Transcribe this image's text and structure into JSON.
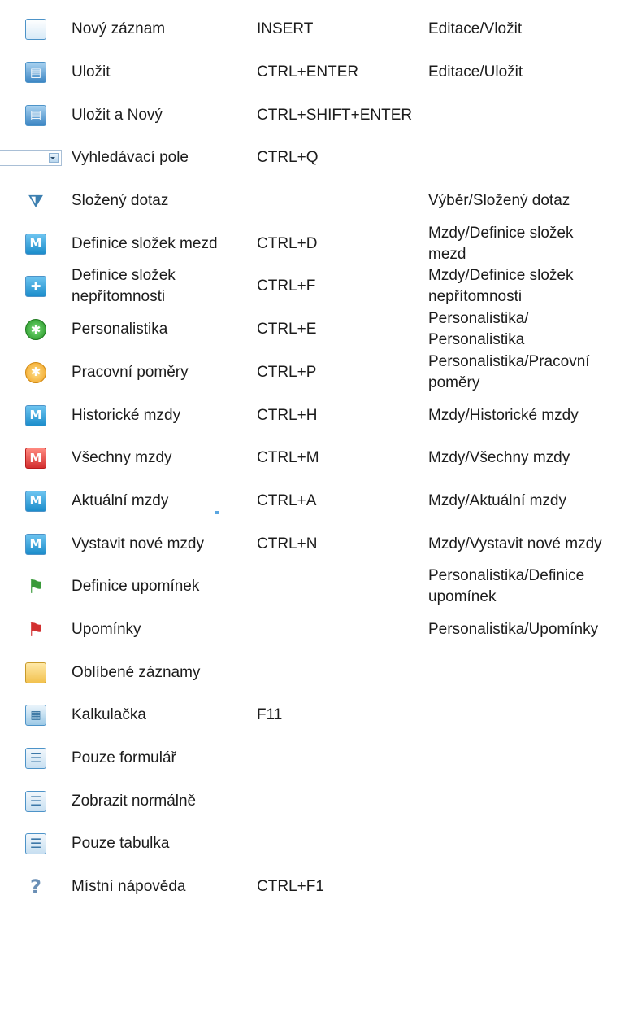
{
  "rows": [
    {
      "icon": "new-record-icon",
      "glyph": "",
      "name": "Nový záznam",
      "key": "INSERT",
      "menu": "Editace/Vložit"
    },
    {
      "icon": "save-icon",
      "glyph": "▤",
      "name": "Uložit",
      "key": "CTRL+ENTER",
      "menu": "Editace/Uložit"
    },
    {
      "icon": "save-and-new-icon",
      "glyph": "▤",
      "name": "Uložit a Nový",
      "key": "CTRL+SHIFT+ENTER",
      "menu": ""
    },
    {
      "icon": "search-field-combo",
      "glyph": "",
      "name": "Vyhledávací pole",
      "key": "CTRL+Q",
      "menu": ""
    },
    {
      "icon": "compound-query-icon",
      "glyph": "⧩",
      "name": "Složený dotaz",
      "key": "",
      "menu": "Výběr/Složený dotaz"
    },
    {
      "icon": "wage-components-icon",
      "glyph": "M",
      "name": "Definice složek mezd",
      "key": "CTRL+D",
      "menu": "Mzdy/Definice složek\nmezd"
    },
    {
      "icon": "absence-components-icon",
      "glyph": "✚",
      "name": "Definice složek\nnepřítomnosti",
      "key": "CTRL+F",
      "menu": "Mzdy/Definice složek\nnepřítomnosti"
    },
    {
      "icon": "personnel-icon",
      "glyph": "✱",
      "name": "Personalistika",
      "key": "CTRL+E",
      "menu": "Personalistika/\nPersonalistika"
    },
    {
      "icon": "employment-icon",
      "glyph": "✱",
      "name": "Pracovní poměry",
      "key": "CTRL+P",
      "menu": "Personalistika/Pracovní\npoměry"
    },
    {
      "icon": "historical-wages-icon",
      "glyph": "M",
      "name": "Historické mzdy",
      "key": "CTRL+H",
      "menu": "Mzdy/Historické mzdy"
    },
    {
      "icon": "all-wages-icon",
      "glyph": "M",
      "name": "Všechny mzdy",
      "key": "CTRL+M",
      "menu": "Mzdy/Všechny mzdy"
    },
    {
      "icon": "current-wages-icon",
      "glyph": "M",
      "name": "Aktuální mzdy",
      "key": "CTRL+A",
      "menu": "Mzdy/Aktuální mzdy"
    },
    {
      "icon": "issue-wages-icon",
      "glyph": "M",
      "name": "Vystavit nové mzdy",
      "key": "CTRL+N",
      "menu": "Mzdy/Vystavit nové mzdy"
    },
    {
      "icon": "reminder-definitions-icon",
      "glyph": "⚑",
      "name": "Definice upomínek",
      "key": "",
      "menu": "Personalistika/Definice\nupomínek"
    },
    {
      "icon": "reminders-icon",
      "glyph": "⚑",
      "name": "Upomínky",
      "key": "",
      "menu": "Personalistika/Upomínky"
    },
    {
      "icon": "favorites-folder-icon",
      "glyph": "",
      "name": "Oblíbené záznamy",
      "key": "",
      "menu": ""
    },
    {
      "icon": "calculator-icon",
      "glyph": "▦",
      "name": "Kalkulačka",
      "key": "F11",
      "menu": ""
    },
    {
      "icon": "form-only-icon",
      "glyph": "☰",
      "name": "Pouze formulář",
      "key": "",
      "menu": ""
    },
    {
      "icon": "normal-view-icon",
      "glyph": "☰",
      "name": "Zobrazit normálně",
      "key": "",
      "menu": ""
    },
    {
      "icon": "table-only-icon",
      "glyph": "☰",
      "name": "Pouze tabulka",
      "key": "",
      "menu": ""
    },
    {
      "icon": "local-help-icon",
      "glyph": "?",
      "name": "Místní nápověda",
      "key": "CTRL+F1",
      "menu": ""
    }
  ],
  "colors": {
    "text": "#1c1c1c",
    "accent": "#1c8dcb"
  }
}
